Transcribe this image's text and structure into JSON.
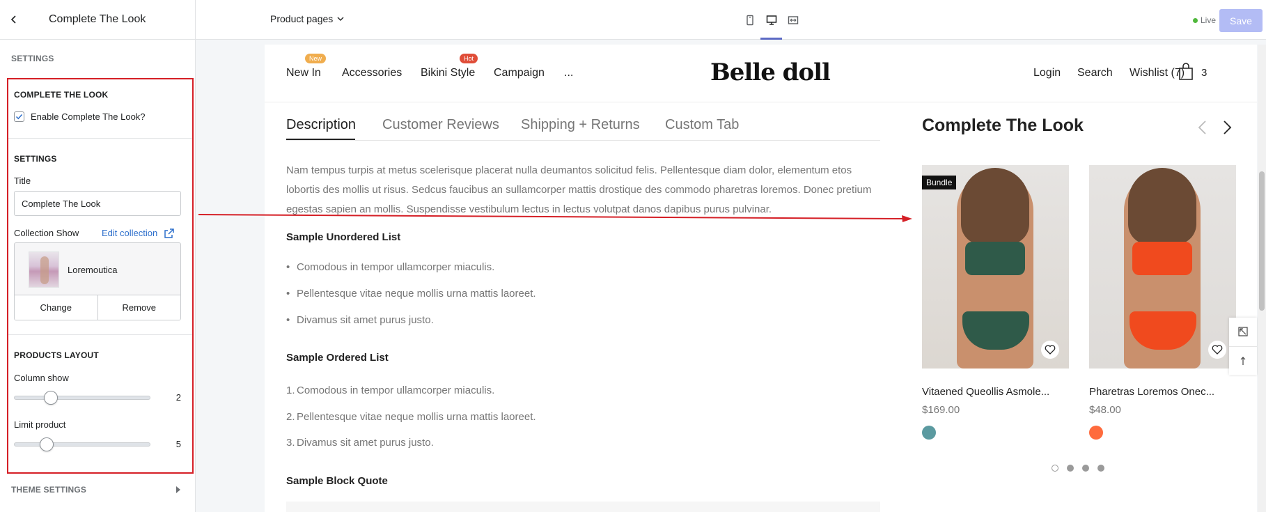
{
  "sidebar": {
    "title": "Complete The Look",
    "settings_label": "SETTINGS",
    "complete_look": {
      "heading": "COMPLETE THE LOOK",
      "enable_label": "Enable Complete The Look?",
      "enabled": true
    },
    "settings": {
      "heading": "SETTINGS",
      "title_label": "Title",
      "title_value": "Complete The Look",
      "collection_label": "Collection Show",
      "edit_collection": "Edit collection",
      "collection_name": "Loremoutica",
      "change_label": "Change",
      "remove_label": "Remove"
    },
    "products_layout": {
      "heading": "PRODUCTS LAYOUT",
      "column_label": "Column show",
      "column_value": "2",
      "limit_label": "Limit product",
      "limit_value": "5"
    },
    "theme_settings": "THEME SETTINGS"
  },
  "topbar": {
    "page_select": "Product pages",
    "live_label": "Live",
    "save_label": "Save"
  },
  "store": {
    "nav": {
      "new_in": "New In",
      "new_badge": "New",
      "accessories": "Accessories",
      "bikini": "Bikini Style",
      "hot_badge": "Hot",
      "campaign": "Campaign",
      "more": "...",
      "brand": "Belle doll",
      "login": "Login",
      "search": "Search",
      "wishlist": "Wishlist (7)",
      "cart_count": "3"
    },
    "tabs": [
      "Description",
      "Customer Reviews",
      "Shipping + Returns",
      "Custom Tab"
    ],
    "description": "Nam tempus turpis at metus scelerisque placerat nulla deumantos solicitud felis. Pellentesque diam dolor, elementum etos lobortis des mollis ut risus. Sedcus faucibus an sullamcorper mattis drostique des commodo pharetras loremos. Donec pretium egestas sapien an mollis. Suspendisse vestibulum lectus in lectus volutpat danos dapibus purus pulvinar.",
    "unordered_heading": "Sample Unordered List",
    "unordered": [
      "Comodous in tempor ullamcorper miaculis.",
      "Pellentesque vitae neque mollis urna mattis laoreet.",
      "Divamus sit amet purus justo."
    ],
    "ordered_heading": "Sample Ordered List",
    "ordered": [
      "Comodous in tempor ullamcorper miaculis.",
      "Pellentesque vitae neque mollis urna mattis laoreet.",
      "Divamus sit amet purus justo."
    ],
    "ordered_markers": [
      "1.",
      "2.",
      "3."
    ],
    "blockquote_heading": "Sample Block Quote",
    "complete_the_look": {
      "title": "Complete The Look",
      "products": [
        {
          "badge": "Bundle",
          "name": "Vitaened Queollis Asmole...",
          "price": "$169.00",
          "swatch": "#5b9aa0"
        },
        {
          "badge": "",
          "name": "Pharetras Loremos Onec...",
          "price": "$48.00",
          "swatch": "#ff6b3d"
        }
      ]
    }
  },
  "colors": {
    "highlight": "#d51f26",
    "accent": "#5c6ac4",
    "new_badge": "#f0ad4e",
    "hot_badge": "#e04e39"
  }
}
